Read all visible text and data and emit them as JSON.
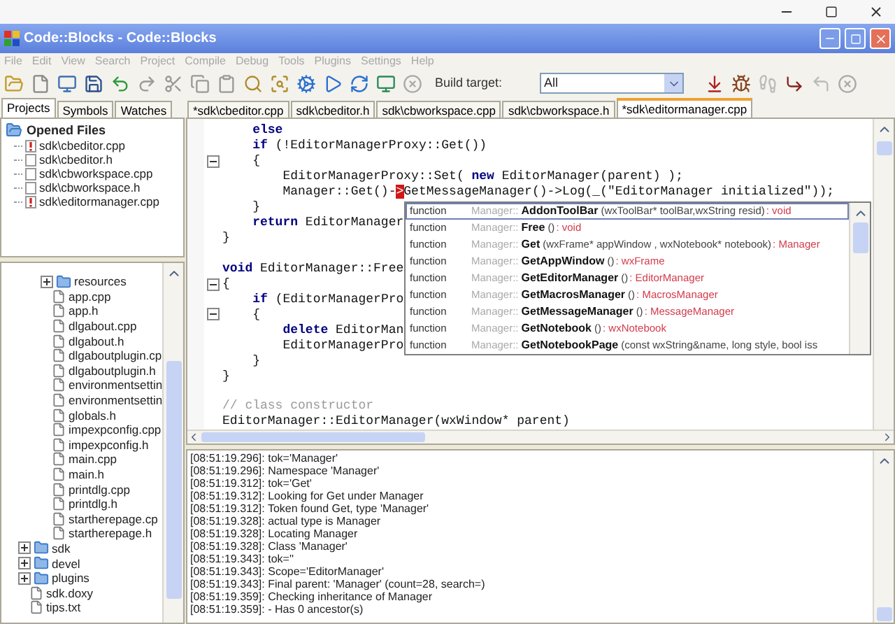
{
  "window": {
    "title": "Code::Blocks - Code::Blocks"
  },
  "menu": [
    "File",
    "Edit",
    "View",
    "Search",
    "Project",
    "Compile",
    "Debug",
    "Tools",
    "Plugins",
    "Settings",
    "Help"
  ],
  "toolbar": {
    "build_target_label": "Build target:",
    "build_target_value": "All"
  },
  "side_tabs": [
    {
      "label": "Projects",
      "selected": true
    },
    {
      "label": "Symbols",
      "selected": false
    },
    {
      "label": "Watches",
      "selected": false
    }
  ],
  "opened_files": {
    "title": "Opened Files",
    "expanded": true,
    "children": [
      {
        "label": "sdk\\cbeditor.cpp",
        "modified": true
      },
      {
        "label": "sdk\\cbeditor.h",
        "modified": false
      },
      {
        "label": "sdk\\cbworkspace.cpp",
        "modified": false
      },
      {
        "label": "sdk\\cbworkspace.h",
        "modified": false
      },
      {
        "label": "sdk\\editormanager.cpp",
        "modified": true
      }
    ]
  },
  "project_tree": {
    "items": [
      {
        "kind": "group",
        "children": [
          {
            "kind": "folder",
            "label": "resources",
            "expanded": false
          },
          {
            "kind": "file",
            "label": "app.cpp"
          },
          {
            "kind": "file",
            "label": "app.h"
          },
          {
            "kind": "file",
            "label": "dlgabout.cpp"
          },
          {
            "kind": "file",
            "label": "dlgabout.h"
          },
          {
            "kind": "file",
            "label": "dlgaboutplugin.cp"
          },
          {
            "kind": "file",
            "label": "dlgaboutplugin.h"
          },
          {
            "kind": "file",
            "label": "environmentsettin"
          },
          {
            "kind": "file",
            "label": "environmentsettin"
          },
          {
            "kind": "file",
            "label": "globals.h"
          },
          {
            "kind": "file",
            "label": "impexpconfig.cpp"
          },
          {
            "kind": "file",
            "label": "impexpconfig.h"
          },
          {
            "kind": "file",
            "label": "main.cpp"
          },
          {
            "kind": "file",
            "label": "main.h"
          },
          {
            "kind": "file",
            "label": "printdlg.cpp"
          },
          {
            "kind": "file",
            "label": "printdlg.h"
          },
          {
            "kind": "file",
            "label": "startherepage.cp"
          },
          {
            "kind": "file",
            "label": "startherepage.h"
          }
        ]
      },
      {
        "kind": "folder",
        "label": "sdk",
        "expanded": false
      },
      {
        "kind": "folder",
        "label": "devel",
        "expanded": false
      },
      {
        "kind": "folder",
        "label": "plugins",
        "expanded": false
      },
      {
        "kind": "file",
        "label": "sdk.doxy"
      },
      {
        "kind": "file",
        "label": "tips.txt"
      }
    ]
  },
  "editor_tabs": [
    {
      "label": "*sdk\\cbeditor.cpp",
      "selected": false
    },
    {
      "label": "sdk\\cbeditor.h",
      "selected": false
    },
    {
      "label": "sdk\\cbworkspace.cpp",
      "selected": false
    },
    {
      "label": "sdk\\cbworkspace.h",
      "selected": false
    },
    {
      "label": "*sdk\\editormanager.cpp",
      "selected": true
    }
  ],
  "code_lines": [
    {
      "kind": "code",
      "fold": false,
      "tokens": [
        {
          "kind": "keyword",
          "text": "    else"
        }
      ]
    },
    {
      "kind": "code",
      "fold": false,
      "tokens": [
        {
          "kind": "keyword",
          "text": "    if"
        },
        {
          "kind": "plain",
          "text": " (!EditorManagerProxy::Get())"
        }
      ]
    },
    {
      "kind": "code",
      "fold": true,
      "tokens": [
        {
          "kind": "plain",
          "text": "    {"
        }
      ]
    },
    {
      "kind": "code",
      "fold": false,
      "tokens": [
        {
          "kind": "plain",
          "text": "        EditorManagerProxy::Set( "
        },
        {
          "kind": "keyword",
          "text": "new"
        },
        {
          "kind": "plain",
          "text": " EditorManager(parent) );"
        }
      ]
    },
    {
      "kind": "code",
      "fold": false,
      "tokens": [
        {
          "kind": "plain",
          "text": "        Manager::Get()-"
        },
        {
          "kind": "cursor",
          "text": ">"
        },
        {
          "kind": "plain",
          "text": "GetMessageManager()->Log(_(\"EditorManager initialized\"));"
        }
      ]
    },
    {
      "kind": "code",
      "fold": false,
      "tokens": [
        {
          "kind": "plain",
          "text": "    }"
        }
      ]
    },
    {
      "kind": "code",
      "fold": false,
      "tokens": [
        {
          "kind": "keyword",
          "text": "    return"
        },
        {
          "kind": "plain",
          "text": " EditorManager"
        }
      ]
    },
    {
      "kind": "code",
      "fold": false,
      "tokens": [
        {
          "kind": "plain",
          "text": "}"
        }
      ]
    },
    {
      "kind": "blank"
    },
    {
      "kind": "code",
      "fold": false,
      "tokens": [
        {
          "kind": "keyword",
          "text": "void"
        },
        {
          "kind": "plain",
          "text": " EditorManager::Free"
        }
      ]
    },
    {
      "kind": "code",
      "fold": true,
      "tokens": [
        {
          "kind": "plain",
          "text": "{"
        }
      ]
    },
    {
      "kind": "code",
      "fold": false,
      "tokens": [
        {
          "kind": "keyword",
          "text": "    if"
        },
        {
          "kind": "plain",
          "text": " (EditorManagerPro"
        }
      ]
    },
    {
      "kind": "code",
      "fold": true,
      "tokens": [
        {
          "kind": "plain",
          "text": "    {"
        }
      ]
    },
    {
      "kind": "code",
      "fold": false,
      "tokens": [
        {
          "kind": "keyword",
          "text": "        delete"
        },
        {
          "kind": "plain",
          "text": " EditorMan"
        }
      ]
    },
    {
      "kind": "code",
      "fold": false,
      "tokens": [
        {
          "kind": "plain",
          "text": "        EditorManagerPro"
        }
      ]
    },
    {
      "kind": "code",
      "fold": false,
      "tokens": [
        {
          "kind": "plain",
          "text": "    }"
        }
      ]
    },
    {
      "kind": "code",
      "fold": false,
      "tokens": [
        {
          "kind": "plain",
          "text": "}"
        }
      ]
    },
    {
      "kind": "blank"
    },
    {
      "kind": "code",
      "fold": false,
      "tokens": [
        {
          "kind": "comment",
          "text": "// class constructor"
        }
      ]
    },
    {
      "kind": "code",
      "fold": false,
      "tokens": [
        {
          "kind": "plain",
          "text": "EditorManager::EditorManager(wxWindow* parent)"
        }
      ]
    }
  ],
  "completion_popup": {
    "items": [
      {
        "category": "function",
        "scope": "Manager::",
        "name": "AddonToolBar",
        "params": "(wxToolBar* toolBar,wxString resid)",
        "type": ": void",
        "selected": true
      },
      {
        "category": "function",
        "scope": "Manager::",
        "name": "Free",
        "params": "()",
        "type": ": void",
        "selected": false
      },
      {
        "category": "function",
        "scope": "Manager::",
        "name": "Get",
        "params": "(wxFrame* appWindow , wxNotebook* notebook)",
        "type": ": Manager",
        "selected": false
      },
      {
        "category": "function",
        "scope": "Manager::",
        "name": "GetAppWindow",
        "params": "()",
        "type": ": wxFrame",
        "selected": false
      },
      {
        "category": "function",
        "scope": "Manager::",
        "name": "GetEditorManager",
        "params": "()",
        "type": ": EditorManager",
        "selected": false
      },
      {
        "category": "function",
        "scope": "Manager::",
        "name": "GetMacrosManager",
        "params": "()",
        "type": ": MacrosManager",
        "selected": false
      },
      {
        "category": "function",
        "scope": "Manager::",
        "name": "GetMessageManager",
        "params": "()",
        "type": ": MessageManager",
        "selected": false
      },
      {
        "category": "function",
        "scope": "Manager::",
        "name": "GetNotebook",
        "params": "()",
        "type": ": wxNotebook",
        "selected": false
      },
      {
        "category": "function",
        "scope": "Manager::",
        "name": "GetNotebookPage",
        "params": "(const wxString&name, long style, bool iss",
        "selected": false
      }
    ]
  },
  "log": {
    "lines": [
      "[08:51:19.296]: tok='Manager'",
      "[08:51:19.296]: Namespace 'Manager'",
      "[08:51:19.312]: tok='Get'",
      "[08:51:19.312]: Looking for Get under Manager",
      "[08:51:19.312]: Token found Get, type 'Manager'",
      "[08:51:19.328]: actual type is Manager",
      "[08:51:19.328]: Locating Manager",
      "[08:51:19.328]: Class 'Manager'",
      "[08:51:19.343]: tok=''",
      "[08:51:19.343]: Scope='EditorManager'",
      "[08:51:19.343]: Final parent: 'Manager' (count=28, search=)",
      "[08:51:19.359]: Checking inheritance of Manager",
      "[08:51:19.359]: - Has 0 ancestor(s)"
    ]
  }
}
